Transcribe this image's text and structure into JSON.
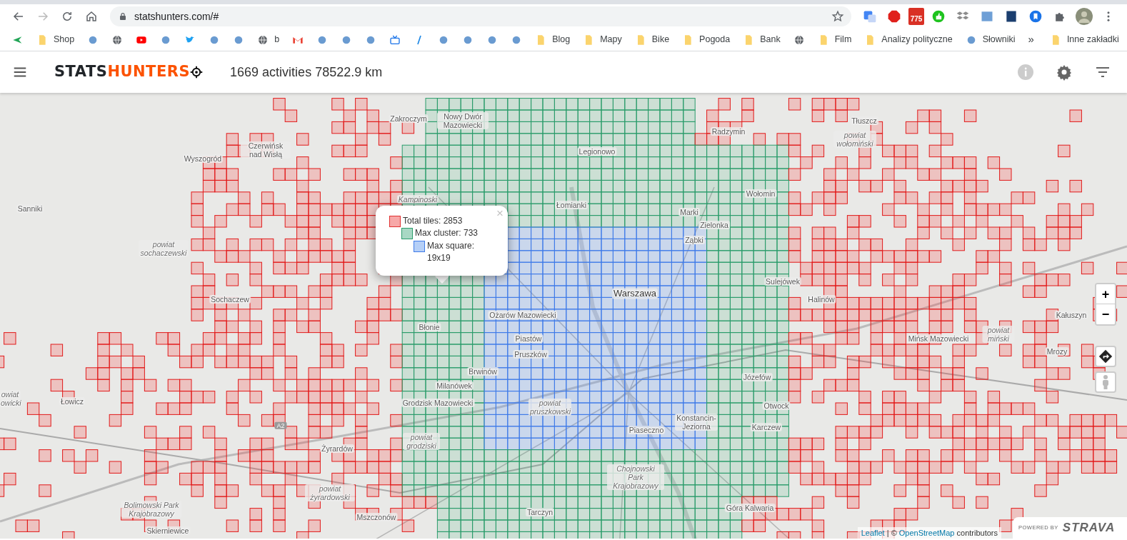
{
  "browser": {
    "url": "statshunters.com/#",
    "extension_badge": "775",
    "bookmarks": [
      {
        "kind": "app"
      },
      {
        "kind": "folder",
        "label": "Shop"
      },
      {
        "kind": "site"
      },
      {
        "kind": "globe"
      },
      {
        "kind": "video"
      },
      {
        "kind": "site"
      },
      {
        "kind": "bird"
      },
      {
        "kind": "site"
      },
      {
        "kind": "site"
      },
      {
        "kind": "globe",
        "label": "b"
      },
      {
        "kind": "mail"
      },
      {
        "kind": "site"
      },
      {
        "kind": "site"
      },
      {
        "kind": "site"
      },
      {
        "kind": "tv"
      },
      {
        "kind": "slash"
      },
      {
        "kind": "site"
      },
      {
        "kind": "site"
      },
      {
        "kind": "site"
      },
      {
        "kind": "site"
      },
      {
        "kind": "folder",
        "label": "Blog"
      },
      {
        "kind": "folder",
        "label": "Mapy"
      },
      {
        "kind": "folder",
        "label": "Bike"
      },
      {
        "kind": "folder",
        "label": "Pogoda"
      },
      {
        "kind": "folder",
        "label": "Bank"
      },
      {
        "kind": "globe"
      },
      {
        "kind": "folder",
        "label": "Film"
      },
      {
        "kind": "folder",
        "label": "Analizy polityczne"
      },
      {
        "kind": "site",
        "label": "Słowniki"
      }
    ],
    "more": "»",
    "other_bookmarks": "Inne zakładki"
  },
  "app": {
    "logo_part_1": "STATS",
    "logo_part_2": "HUNTERS",
    "summary": "1669 activities 78522.9 km"
  },
  "map": {
    "labels": [
      {
        "kind": "town",
        "text": "Zakroczym"
      },
      {
        "kind": "town",
        "text": "Nowy Dwór Mazowiecki"
      },
      {
        "kind": "town",
        "text": "Legionowo"
      },
      {
        "kind": "town",
        "text": "Radzymin"
      },
      {
        "kind": "town",
        "text": "Tłuszcz"
      },
      {
        "kind": "district",
        "text": "powiat wołomiński"
      },
      {
        "kind": "town",
        "text": "Czerwińsk nad Wisłą"
      },
      {
        "kind": "town",
        "text": "Wyszogród"
      },
      {
        "kind": "town",
        "text": "Sanniki"
      },
      {
        "kind": "district",
        "text": "Kampinoski"
      },
      {
        "kind": "town",
        "text": "Łomianki"
      },
      {
        "kind": "town",
        "text": "Marki"
      },
      {
        "kind": "town",
        "text": "Zielonka"
      },
      {
        "kind": "town",
        "text": "Ząbki"
      },
      {
        "kind": "town",
        "text": "Wołomin"
      },
      {
        "kind": "district",
        "text": "powiat sochaczewski"
      },
      {
        "kind": "town",
        "text": "Sochaczew"
      },
      {
        "kind": "city",
        "text": "Warszawa"
      },
      {
        "kind": "town",
        "text": "Sulejówek"
      },
      {
        "kind": "town",
        "text": "Halinów"
      },
      {
        "kind": "town",
        "text": "Kałuszyn"
      },
      {
        "kind": "town",
        "text": "Mińsk Mazowiecki"
      },
      {
        "kind": "district",
        "text": "powiat miński"
      },
      {
        "kind": "town",
        "text": "Mrozy"
      },
      {
        "kind": "town",
        "text": "Ożarów Mazowiecki"
      },
      {
        "kind": "town",
        "text": "Błonie"
      },
      {
        "kind": "town",
        "text": "Piastów"
      },
      {
        "kind": "town",
        "text": "Pruszków"
      },
      {
        "kind": "town",
        "text": "Brwinów"
      },
      {
        "kind": "town",
        "text": "Milanówek"
      },
      {
        "kind": "town",
        "text": "Grodzisk Mazowiecki"
      },
      {
        "kind": "district",
        "text": "powiat pruszkowski"
      },
      {
        "kind": "town",
        "text": "Józefów"
      },
      {
        "kind": "town",
        "text": "Otwock"
      },
      {
        "kind": "town",
        "text": "Konstancin-Jeziorna"
      },
      {
        "kind": "town",
        "text": "Karczew"
      },
      {
        "kind": "town",
        "text": "Piaseczno"
      },
      {
        "kind": "district",
        "text": "owiat owicki"
      },
      {
        "kind": "town",
        "text": "Łowicz"
      },
      {
        "kind": "town",
        "text": "Żyrardów"
      },
      {
        "kind": "district",
        "text": "powiat grodziski"
      },
      {
        "kind": "road",
        "text": "A2"
      },
      {
        "kind": "district",
        "text": "powiat żyrardowski"
      },
      {
        "kind": "district",
        "text": "Bolimowski Park Krajobrazowy"
      },
      {
        "kind": "town",
        "text": "Mszczonów"
      },
      {
        "kind": "town",
        "text": "Tarczyn"
      },
      {
        "kind": "town",
        "text": "Skierniewice"
      },
      {
        "kind": "district",
        "text": "Chojnowski Park Krajobrazowy"
      },
      {
        "kind": "town",
        "text": "Góra Kalwaria"
      }
    ],
    "popup": {
      "close": "×",
      "legend": [
        {
          "label": "Total tiles: 2853",
          "color": "#f7a8a8"
        },
        {
          "label": "Max cluster: 733",
          "color": "#a8d8c4"
        },
        {
          "label": "Max square: 19x19",
          "color": "#b5cff7"
        }
      ]
    },
    "zoom_in": "+",
    "zoom_out": "−",
    "attribution": [
      {
        "kind": "link",
        "text": "Leaflet"
      },
      {
        "kind": "text",
        "text": " | © "
      },
      {
        "kind": "link",
        "text": "OpenStreetMap"
      },
      {
        "kind": "text",
        "text": " contributors"
      }
    ],
    "powered_by": "POWERED BY",
    "strava": "STRAVA"
  }
}
